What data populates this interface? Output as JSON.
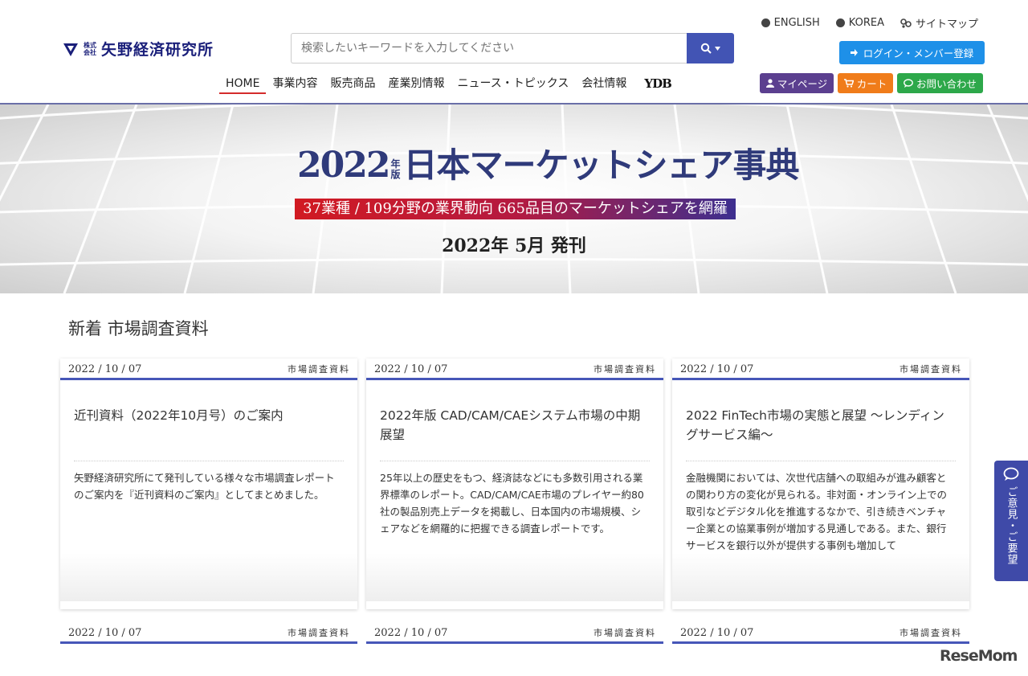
{
  "header": {
    "logo_small_1": "株式",
    "logo_small_2": "会社",
    "logo_text": "矢野経済研究所",
    "search_placeholder": "検索したいキーワードを入力してください",
    "toplinks": [
      "ENGLISH",
      "KOREA",
      "サイトマップ"
    ],
    "login_label": "ログイン・メンバー登録",
    "nav": [
      "HOME",
      "事業内容",
      "販売商品",
      "産業別情報",
      "ニュース・トピックス",
      "会社情報",
      "YDB"
    ],
    "mypage_label": "マイページ",
    "cart_label": "カート",
    "contact_label": "お問い合わせ"
  },
  "banner": {
    "year": "2022",
    "ban_1": "年",
    "ban_2": "版",
    "title": "日本マーケットシェア事典",
    "strip": "37業種 / 109分野の業界動向 665品目のマーケットシェアを網羅",
    "date": "2022年 5月 発刊"
  },
  "section": {
    "title": "新着 市場調査資料"
  },
  "cards": [
    {
      "date": "2022 / 10 / 07",
      "category": "市場調査資料",
      "title": "近刊資料（2022年10月号）のご案内",
      "text": "矢野経済研究所にて発刊している様々な市場調査レポートのご案内を『近刊資料のご案内』としてまとめました。"
    },
    {
      "date": "2022 / 10 / 07",
      "category": "市場調査資料",
      "title": "2022年版 CAD/CAM/CAEシステム市場の中期展望",
      "text": "25年以上の歴史をもつ、経済誌などにも多数引用される業界標準のレポート。CAD/CAM/CAE市場のプレイヤー約80社の製品別売上データを掲載し、日本国内の市場規模、シェアなどを網羅的に把握できる調査レポートです。"
    },
    {
      "date": "2022 / 10 / 07",
      "category": "市場調査資料",
      "title": "2022 FinTech市場の実態と展望 ～レンディングサービス編～",
      "text": "金融機関においては、次世代店舗への取組みが進み顧客との関わり方の変化が見られる。非対面・オンライン上での取引などデジタル化を推進するなかで、引き続きベンチャー企業との協業事例が増加する見通しである。また、銀行サービスを銀行以外が提供する事例も増加して"
    }
  ],
  "cards_row2": [
    {
      "date": "2022 / 10 / 07",
      "category": "市場調査資料"
    },
    {
      "date": "2022 / 10 / 07",
      "category": "市場調査資料"
    },
    {
      "date": "2022 / 10 / 07",
      "category": "市場調査資料"
    }
  ],
  "feedback_label": "ご意見・ご要望",
  "watermark": "ReseMom",
  "colors": {
    "accent": "#4254b4",
    "login": "#1e90e8",
    "mypage": "#5b3f8f",
    "cart": "#f07c1a",
    "contact": "#2da84a",
    "nav_active": "#d42c2c"
  }
}
